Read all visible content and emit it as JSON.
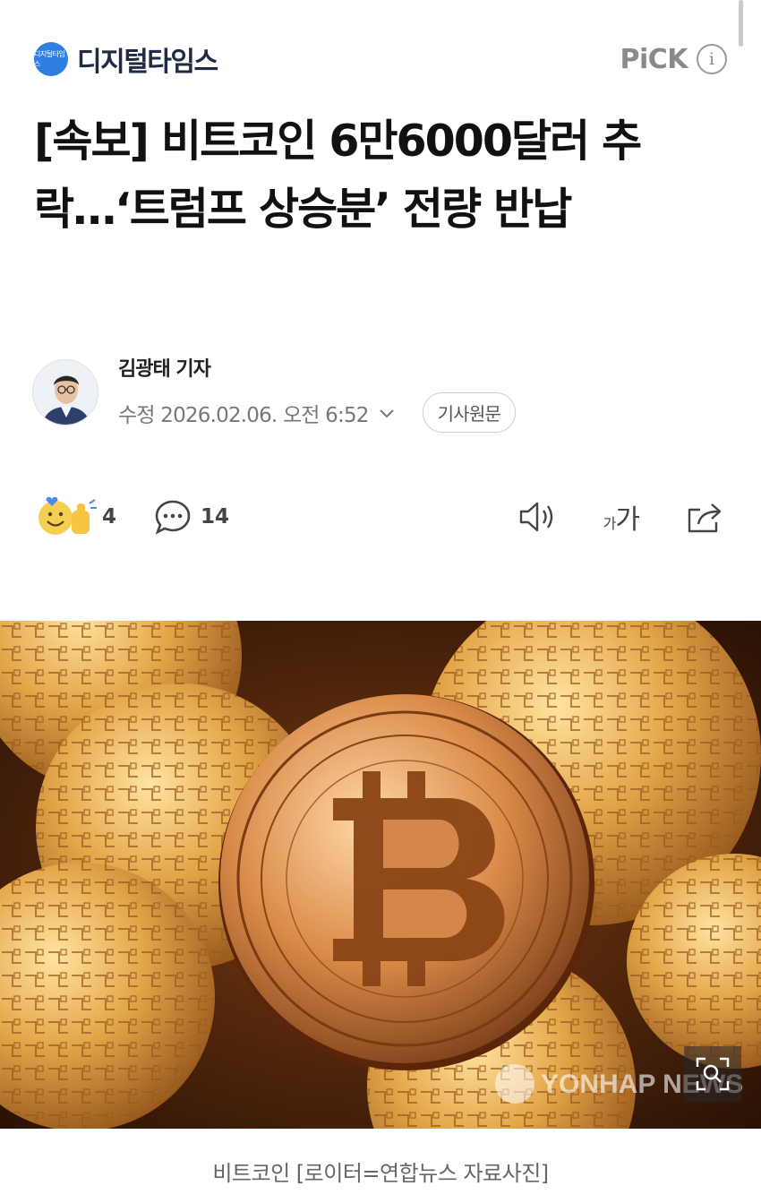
{
  "header": {
    "press_logo_text": "디지털타임스",
    "press_name": "디지털타임스",
    "pick_label": "PiCK",
    "info_icon": "i"
  },
  "article": {
    "headline": "[속보] 비트코인 6만6000달러 추락…‘트럼프 상승분’ 전량 반납",
    "reporter": "김광태 기자",
    "modified": "수정 2026.02.06. 오전 6:52",
    "original_button": "기사원문"
  },
  "actions": {
    "reaction_count": "4",
    "comment_count": "14",
    "fontsize_small": "가",
    "fontsize_large": "가"
  },
  "photo": {
    "watermark": "YONHAP NEWS",
    "caption": "비트코인 [로이터=연합뉴스 자료사진]"
  },
  "icons": [
    "info-icon",
    "chevron-down-icon",
    "reaction-emoji-icon",
    "comment-icon",
    "speaker-icon",
    "font-size-icon",
    "share-icon",
    "zoom-icon"
  ],
  "colors": {
    "brand_blue": "#2f7fe0",
    "coin_gold": "#d8902e",
    "text_gray": "#777777"
  }
}
